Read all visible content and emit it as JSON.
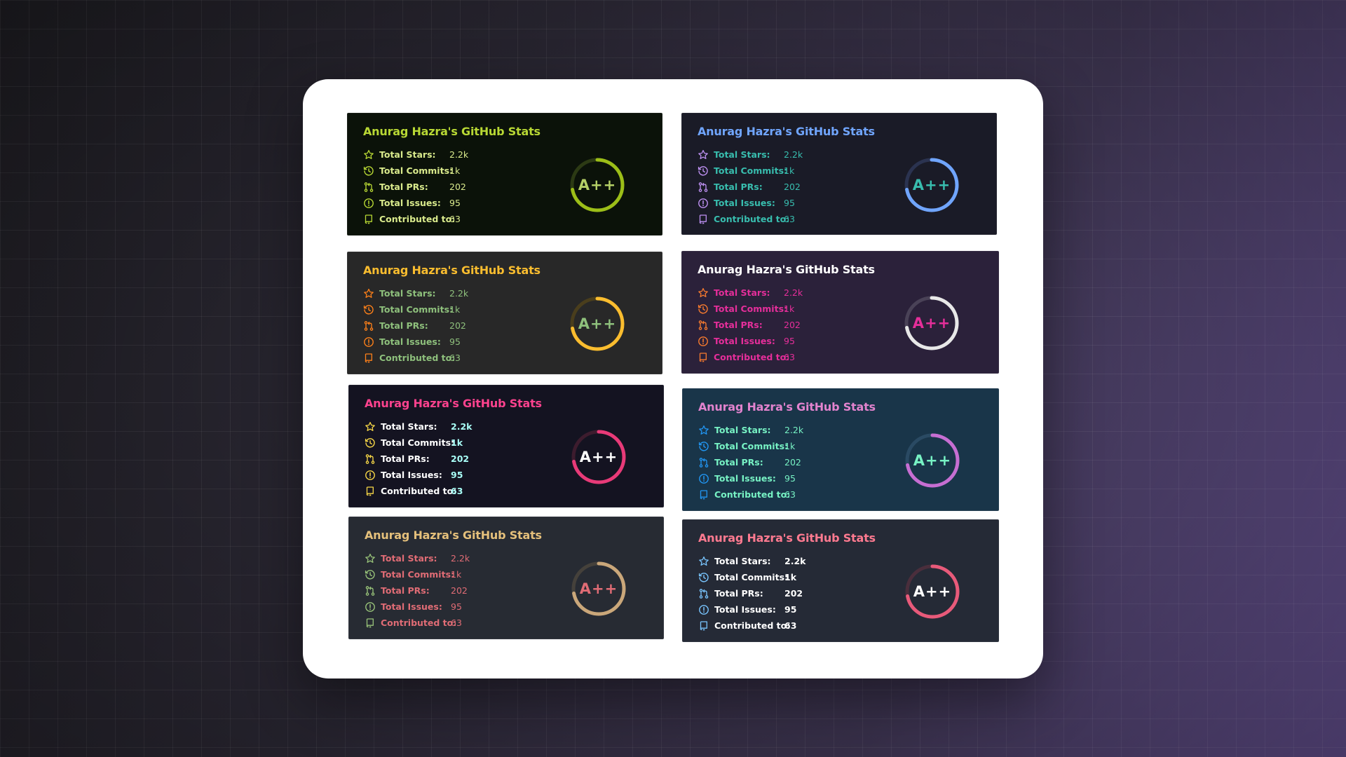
{
  "cards": [
    {
      "id": "card-1",
      "title": "Anurag Hazra's GitHub Stats",
      "bg": "#0b1209",
      "title_color": "#b8d834",
      "icon_color": "#b8d834",
      "label_color": "#d9ea8c",
      "value_color": "#d9ea8c",
      "ring_color": "#9cbe18",
      "ring_bg": "#2c3a14",
      "rank_color": "#b4cf66",
      "stats": [
        {
          "icon": "star-icon",
          "label": "Total Stars:",
          "value": "2.2k"
        },
        {
          "icon": "commits-icon",
          "label": "Total Commits:",
          "value": "1k"
        },
        {
          "icon": "pull-request-icon",
          "label": "Total PRs:",
          "value": "202"
        },
        {
          "icon": "issue-icon",
          "label": "Total Issues:",
          "value": "95"
        },
        {
          "icon": "repo-icon",
          "label": "Contributed to:",
          "value": "63"
        }
      ],
      "rank": "A++"
    },
    {
      "id": "card-2",
      "title": "Anurag Hazra's GitHub Stats",
      "bg": "#1a1b27",
      "title_color": "#70a5fd",
      "icon_color": "#bf91f3",
      "label_color": "#38bdae",
      "value_color": "#38bdae",
      "ring_color": "#70a5fd",
      "ring_bg": "#2b3350",
      "rank_color": "#38bdae",
      "stats": [
        {
          "icon": "star-icon",
          "label": "Total Stars:",
          "value": "2.2k"
        },
        {
          "icon": "commits-icon",
          "label": "Total Commits:",
          "value": "1k"
        },
        {
          "icon": "pull-request-icon",
          "label": "Total PRs:",
          "value": "202"
        },
        {
          "icon": "issue-icon",
          "label": "Total Issues:",
          "value": "95"
        },
        {
          "icon": "repo-icon",
          "label": "Contributed to:",
          "value": "63"
        }
      ],
      "rank": "A++"
    },
    {
      "id": "card-3",
      "title": "Anurag Hazra's GitHub Stats",
      "bg": "#282828",
      "title_color": "#fabd2f",
      "icon_color": "#fe8019",
      "label_color": "#8ec07c",
      "value_color": "#8ec07c",
      "ring_color": "#fabd2f",
      "ring_bg": "#4a3e1c",
      "rank_color": "#8ec07c",
      "stats": [
        {
          "icon": "star-icon",
          "label": "Total Stars:",
          "value": "2.2k"
        },
        {
          "icon": "commits-icon",
          "label": "Total Commits:",
          "value": "1k"
        },
        {
          "icon": "pull-request-icon",
          "label": "Total PRs:",
          "value": "202"
        },
        {
          "icon": "issue-icon",
          "label": "Total Issues:",
          "value": "95"
        },
        {
          "icon": "repo-icon",
          "label": "Contributed to:",
          "value": "63"
        }
      ],
      "rank": "A++"
    },
    {
      "id": "card-4",
      "title": "Anurag Hazra's GitHub Stats",
      "bg": "#2b213a",
      "title_color": "#ffffff",
      "icon_color": "#f97b2e",
      "label_color": "#e52e9a",
      "value_color": "#e52e9a",
      "ring_color": "#e8e8e8",
      "ring_bg": "#4a4257",
      "rank_color": "#e52e9a",
      "stats": [
        {
          "icon": "star-icon",
          "label": "Total Stars:",
          "value": "2.2k"
        },
        {
          "icon": "commits-icon",
          "label": "Total Commits:",
          "value": "1k"
        },
        {
          "icon": "pull-request-icon",
          "label": "Total PRs:",
          "value": "202"
        },
        {
          "icon": "issue-icon",
          "label": "Total Issues:",
          "value": "95"
        },
        {
          "icon": "repo-icon",
          "label": "Contributed to:",
          "value": "63"
        }
      ],
      "rank": "A++"
    },
    {
      "id": "card-5",
      "title": "Anurag Hazra's GitHub Stats",
      "bg": "#141321",
      "title_color": "#fe428e",
      "icon_color": "#f8d847",
      "label_color": "#ffffff",
      "value_color": "#a9fef7",
      "ring_color": "#e83a78",
      "ring_bg": "#3d1c2e",
      "rank_color": "#ffffff",
      "stats": [
        {
          "icon": "star-icon",
          "label": "Total Stars:",
          "value": "2.2k"
        },
        {
          "icon": "commits-icon",
          "label": "Total Commits:",
          "value": "1k"
        },
        {
          "icon": "pull-request-icon",
          "label": "Total PRs:",
          "value": "202"
        },
        {
          "icon": "issue-icon",
          "label": "Total Issues:",
          "value": "95"
        },
        {
          "icon": "repo-icon",
          "label": "Contributed to:",
          "value": "63"
        }
      ],
      "rank": "A++"
    },
    {
      "id": "card-6",
      "title": "Anurag Hazra's GitHub Stats",
      "bg": "#193549",
      "title_color": "#e283ce",
      "icon_color": "#2196f3",
      "label_color": "#77f2c4",
      "value_color": "#77f2c4",
      "ring_color": "#c66ed2",
      "ring_bg": "#2a4a63",
      "rank_color": "#77f2c4",
      "stats": [
        {
          "icon": "star-icon",
          "label": "Total Stars:",
          "value": "2.2k"
        },
        {
          "icon": "commits-icon",
          "label": "Total Commits:",
          "value": "1k"
        },
        {
          "icon": "pull-request-icon",
          "label": "Total PRs:",
          "value": "202"
        },
        {
          "icon": "issue-icon",
          "label": "Total Issues:",
          "value": "95"
        },
        {
          "icon": "repo-icon",
          "label": "Contributed to:",
          "value": "63"
        }
      ],
      "rank": "A++"
    },
    {
      "id": "card-7",
      "title": "Anurag Hazra's GitHub Stats",
      "bg": "#272b33",
      "title_color": "#e5c07b",
      "icon_color": "#98c379",
      "label_color": "#e06c75",
      "value_color": "#e06c75",
      "ring_color": "#caa77a",
      "ring_bg": "#45413b",
      "rank_color": "#e06c75",
      "stats": [
        {
          "icon": "star-icon",
          "label": "Total Stars:",
          "value": "2.2k"
        },
        {
          "icon": "commits-icon",
          "label": "Total Commits:",
          "value": "1k"
        },
        {
          "icon": "pull-request-icon",
          "label": "Total PRs:",
          "value": "202"
        },
        {
          "icon": "issue-icon",
          "label": "Total Issues:",
          "value": "95"
        },
        {
          "icon": "repo-icon",
          "label": "Contributed to:",
          "value": "63"
        }
      ],
      "rank": "A++"
    },
    {
      "id": "card-8",
      "title": "Anurag Hazra's GitHub Stats",
      "bg": "#252a36",
      "title_color": "#ff7a90",
      "icon_color": "#79c5ff",
      "label_color": "#ffffff",
      "value_color": "#ffffff",
      "ring_color": "#e85a7a",
      "ring_bg": "#4a2e3c",
      "rank_color": "#ffffff",
      "stats": [
        {
          "icon": "star-icon",
          "label": "Total Stars:",
          "value": "2.2k"
        },
        {
          "icon": "commits-icon",
          "label": "Total Commits:",
          "value": "1k"
        },
        {
          "icon": "pull-request-icon",
          "label": "Total PRs:",
          "value": "202"
        },
        {
          "icon": "issue-icon",
          "label": "Total Issues:",
          "value": "95"
        },
        {
          "icon": "repo-icon",
          "label": "Contributed to:",
          "value": "63"
        }
      ],
      "rank": "A++"
    }
  ]
}
